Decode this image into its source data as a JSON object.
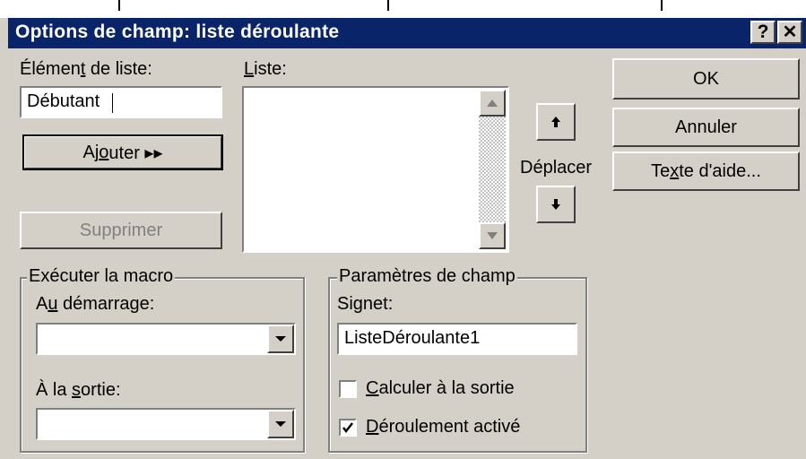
{
  "dialog": {
    "title": "Options de champ: liste déroulante",
    "help_label": "?",
    "close_label": "✕"
  },
  "list_item": {
    "label_pre": "Élémen",
    "label_key": "t",
    "label_post": " de liste:",
    "value": "Débutant"
  },
  "list": {
    "label_key": "L",
    "label_post": "iste:"
  },
  "buttons": {
    "add_pre": "Aj",
    "add_key": "o",
    "add_post": "uter ▸▸",
    "delete": "Supprimer",
    "ok": "OK",
    "cancel": "Annuler",
    "help_pre": "Te",
    "help_key": "x",
    "help_post": "te d'aide..."
  },
  "move": {
    "label": "Déplacer",
    "up_glyph": "🡅",
    "down_glyph": "🡇"
  },
  "macro_group": {
    "legend": "Exécuter la macro",
    "entry_pre": "A",
    "entry_key": "u",
    "entry_post": " démarrage:",
    "exit_pre": "À la ",
    "exit_key": "s",
    "exit_post": "ortie:"
  },
  "field_group": {
    "legend": "Paramètres de champ",
    "bookmark_pre": "Si",
    "bookmark_key": "g",
    "bookmark_post": "net:",
    "bookmark_value": "ListeDéroulante1",
    "calc_key": "C",
    "calc_post": "alculer à la sortie",
    "calc_checked": false,
    "enabled_key": "D",
    "enabled_post": "éroulement activé",
    "enabled_checked": true
  }
}
